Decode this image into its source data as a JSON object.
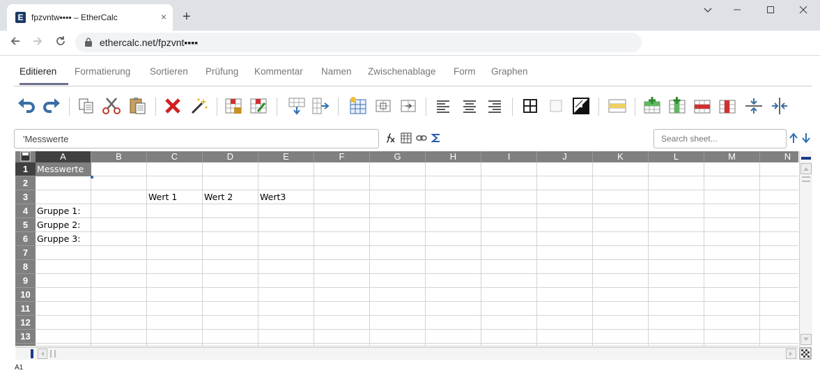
{
  "browser": {
    "tab_title": "fpzvntw▪▪▪▪ – EtherCalc",
    "favicon_letter": "E",
    "tab_close": "×",
    "new_tab": "+",
    "url": "ethercalc.net/fpzvnt▪▪▪▪",
    "window_controls": [
      "minimize-icon",
      "maximize-icon",
      "close-icon"
    ]
  },
  "menu": {
    "items": [
      "Editieren",
      "Formatierung",
      "Sortieren",
      "Prüfung",
      "Kommentar",
      "Namen",
      "Zwischenablage",
      "Form",
      "Graphen"
    ],
    "active": "Editieren"
  },
  "toolbar": {
    "icons": [
      "undo-icon",
      "redo-icon",
      "copy-icon",
      "cut-icon",
      "paste-icon",
      "delete-icon",
      "paste-format-icon",
      "lock-cell-icon",
      "unlock-cell-icon",
      "fill-down-icon",
      "fill-right-icon",
      "insert-column-before-icon",
      "merge-cells-icon",
      "split-cells-icon",
      "align-left-icon",
      "align-center-icon",
      "align-right-icon",
      "borders-icon",
      "no-border-icon",
      "color-icon",
      "swap-colors-icon",
      "insert-row-icon",
      "insert-column-icon",
      "delete-row-icon",
      "delete-column-icon",
      "hide-row-icon",
      "hide-column-icon"
    ]
  },
  "formula_bar": {
    "value": "'Messwerte",
    "search_placeholder": "Search sheet..."
  },
  "sheet": {
    "columns": [
      "A",
      "B",
      "C",
      "D",
      "E",
      "F",
      "G",
      "H",
      "I",
      "J",
      "K",
      "L",
      "M",
      "N"
    ],
    "rows": [
      "1",
      "2",
      "3",
      "4",
      "5",
      "6",
      "7",
      "8",
      "9",
      "10",
      "11",
      "12",
      "13"
    ],
    "selected_cell": "A1",
    "cells": {
      "A1": "Messwerte",
      "C3": "Wert 1",
      "D3": "Wert 2",
      "E3": "Wert3",
      "A4": "Gruppe 1:",
      "A5": "Gruppe 2:",
      "A6": "Gruppe 3:"
    }
  },
  "status": {
    "cell_ref": "A1"
  },
  "colors": {
    "header_gray": "#808080",
    "header_selected": "#404040",
    "menu_underline": "#6e6e8e"
  }
}
